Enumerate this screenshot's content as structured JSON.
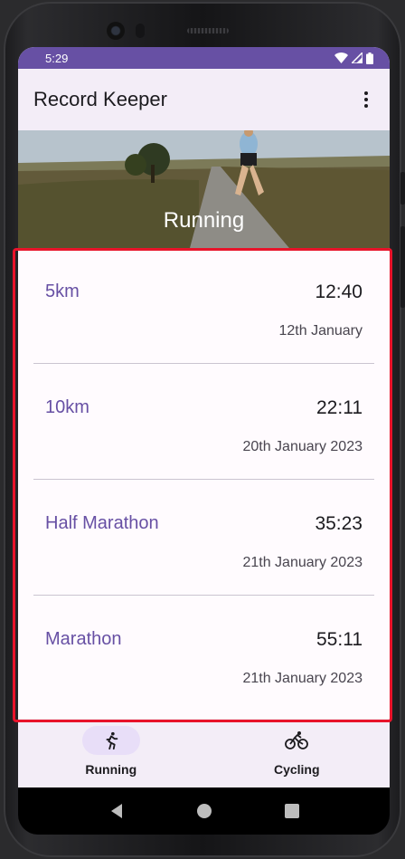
{
  "status_bar": {
    "time": "5:29"
  },
  "app_bar": {
    "title": "Record Keeper",
    "overflow_icon": "more-vert-icon"
  },
  "hero": {
    "title": "Running"
  },
  "records": [
    {
      "name": "5km",
      "time": "12:40",
      "date": "12th January"
    },
    {
      "name": "10km",
      "time": "22:11",
      "date": "20th January 2023"
    },
    {
      "name": "Half Marathon",
      "time": "35:23",
      "date": "21th January 2023"
    },
    {
      "name": "Marathon",
      "time": "55:11",
      "date": "21th January 2023"
    }
  ],
  "bottom_nav": {
    "items": [
      {
        "label": "Running",
        "icon": "running-icon",
        "selected": true
      },
      {
        "label": "Cycling",
        "icon": "cycling-icon",
        "selected": false
      }
    ]
  },
  "colors": {
    "primary": "#6750a4",
    "surface": "#f3edf7",
    "highlight_border": "#e8132a"
  }
}
